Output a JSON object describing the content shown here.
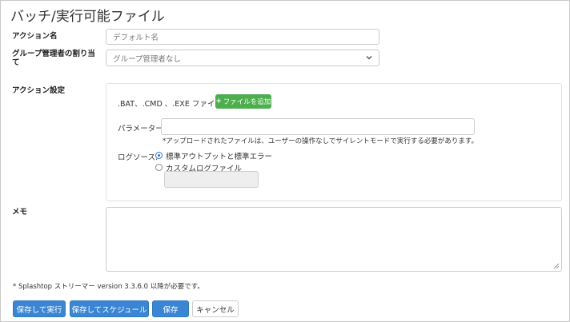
{
  "page": {
    "title": "バッチ/実行可能ファイル"
  },
  "form": {
    "action_name": {
      "label": "アクション名",
      "placeholder": "デフォルト名"
    },
    "group_admin": {
      "label": "グループ管理者の割り当て",
      "selected": "グループ管理者なし"
    },
    "action_settings": {
      "label": "アクション設定",
      "file_label": ".BAT、.CMD 、.EXE ファイル:",
      "add_file_button": "ファイルを追加",
      "param_label": "パラメーター:",
      "param_value": "",
      "upload_note": "*アップロードされたファイルは、ユーザーの操作なしでサイレントモードで実行する必要があります。",
      "log_source_label": "ログソース:",
      "log_options": [
        {
          "label": "標準アウトプットと標準エラー",
          "selected": true
        },
        {
          "label": "カスタムログファイル",
          "selected": false
        }
      ],
      "custom_log_value": ""
    },
    "memo": {
      "label": "メモ",
      "value": ""
    }
  },
  "footer_note": "* Splashtop ストリーマー version 3.3.6.0 以降が必要です。",
  "buttons": {
    "save_and_run": "保存して実行",
    "save_and_schedule": "保存してスケジュール",
    "save": "保存",
    "cancel": "キャンセル"
  },
  "colors": {
    "primary": "#3a86d4",
    "success": "#4cae4c",
    "radio_selected": "#2f6ed8"
  },
  "icons": {
    "plus": "plus-icon",
    "dropdown": "chevron-down-icon",
    "resize": "resize-grip-icon"
  }
}
